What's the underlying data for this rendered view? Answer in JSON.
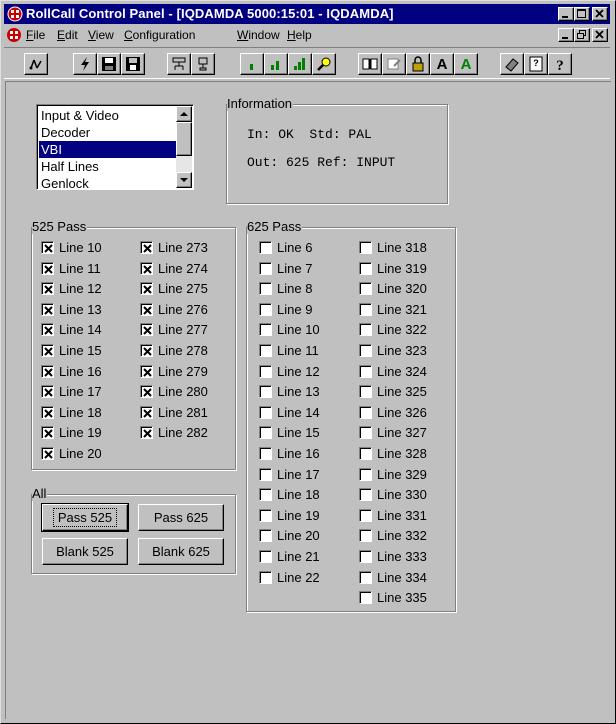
{
  "window": {
    "title": "RollCall Control Panel - [IQDAMDA 5000:15:01 - IQDAMDA]",
    "app_icon": "rollcall-icon",
    "caption_buttons": [
      "minimize",
      "maximize",
      "close"
    ]
  },
  "menu": {
    "items": [
      {
        "label": "File",
        "accel": "F"
      },
      {
        "label": "Edit",
        "accel": "E"
      },
      {
        "label": "View",
        "accel": "V"
      },
      {
        "label": "Configuration",
        "accel": "C"
      },
      {
        "label": "Window",
        "accel": "W"
      },
      {
        "label": "Help",
        "accel": "H"
      }
    ]
  },
  "toolbar": {
    "buttons": [
      "connect-icon",
      "flash-icon",
      "save-icon",
      "save-all-icon",
      "network-icon",
      "device-icon",
      "level-low-icon",
      "level-mid-icon",
      "level-high-icon",
      "search-icon",
      "book-icon",
      "edit-icon",
      "lock-icon",
      "font-a-icon",
      "font-a-green-icon",
      "eraser-icon",
      "help-about-icon",
      "help-context-icon"
    ],
    "font_a": "A"
  },
  "category_list": {
    "items": [
      "Input & Video",
      "Decoder",
      "VBI",
      "Half Lines",
      "Genlock"
    ],
    "selected": "VBI"
  },
  "information": {
    "title": "Information",
    "line1": "In: OK  Std: PAL",
    "line2": "Out: 625 Ref: INPUT"
  },
  "pass525": {
    "title": "525 Pass",
    "col1": [
      {
        "label": "Line 10",
        "checked": true
      },
      {
        "label": "Line 11",
        "checked": true
      },
      {
        "label": "Line 12",
        "checked": true
      },
      {
        "label": "Line 13",
        "checked": true
      },
      {
        "label": "Line 14",
        "checked": true
      },
      {
        "label": "Line 15",
        "checked": true
      },
      {
        "label": "Line 16",
        "checked": true
      },
      {
        "label": "Line 17",
        "checked": true
      },
      {
        "label": "Line 18",
        "checked": true
      },
      {
        "label": "Line 19",
        "checked": true
      },
      {
        "label": "Line 20",
        "checked": true
      }
    ],
    "col2": [
      {
        "label": "Line 273",
        "checked": true
      },
      {
        "label": "Line 274",
        "checked": true
      },
      {
        "label": "Line 275",
        "checked": true
      },
      {
        "label": "Line 276",
        "checked": true
      },
      {
        "label": "Line 277",
        "checked": true
      },
      {
        "label": "Line 278",
        "checked": true
      },
      {
        "label": "Line 279",
        "checked": true
      },
      {
        "label": "Line 280",
        "checked": true
      },
      {
        "label": "Line 281",
        "checked": true
      },
      {
        "label": "Line 282",
        "checked": true
      }
    ]
  },
  "all": {
    "title": "All",
    "pass525": "Pass 525",
    "pass625": "Pass 625",
    "blank525": "Blank 525",
    "blank625": "Blank 625"
  },
  "pass625": {
    "title": "625 Pass",
    "col1": [
      {
        "label": "Line 6",
        "checked": false
      },
      {
        "label": "Line 7",
        "checked": false
      },
      {
        "label": "Line 8",
        "checked": false
      },
      {
        "label": "Line 9",
        "checked": false
      },
      {
        "label": "Line 10",
        "checked": false
      },
      {
        "label": "Line 11",
        "checked": false
      },
      {
        "label": "Line 12",
        "checked": false
      },
      {
        "label": "Line 13",
        "checked": false
      },
      {
        "label": "Line 14",
        "checked": false
      },
      {
        "label": "Line 15",
        "checked": false
      },
      {
        "label": "Line 16",
        "checked": false
      },
      {
        "label": "Line 17",
        "checked": false
      },
      {
        "label": "Line 18",
        "checked": false
      },
      {
        "label": "Line 19",
        "checked": false
      },
      {
        "label": "Line 20",
        "checked": false
      },
      {
        "label": "Line 21",
        "checked": false
      },
      {
        "label": "Line 22",
        "checked": false
      }
    ],
    "col2": [
      {
        "label": "Line 318",
        "checked": false
      },
      {
        "label": "Line 319",
        "checked": false
      },
      {
        "label": "Line 320",
        "checked": false
      },
      {
        "label": "Line 321",
        "checked": false
      },
      {
        "label": "Line 322",
        "checked": false
      },
      {
        "label": "Line 323",
        "checked": false
      },
      {
        "label": "Line 324",
        "checked": false
      },
      {
        "label": "Line 325",
        "checked": false
      },
      {
        "label": "Line 326",
        "checked": false
      },
      {
        "label": "Line 327",
        "checked": false
      },
      {
        "label": "Line 328",
        "checked": false
      },
      {
        "label": "Line 329",
        "checked": false
      },
      {
        "label": "Line 330",
        "checked": false
      },
      {
        "label": "Line 331",
        "checked": false
      },
      {
        "label": "Line 332",
        "checked": false
      },
      {
        "label": "Line 333",
        "checked": false
      },
      {
        "label": "Line 334",
        "checked": false
      },
      {
        "label": "Line 335",
        "checked": false
      }
    ]
  },
  "colors": {
    "title_bar": "#000080",
    "face": "#c0c0c0",
    "selection": "#000080",
    "accent_red": "#cc0000"
  }
}
